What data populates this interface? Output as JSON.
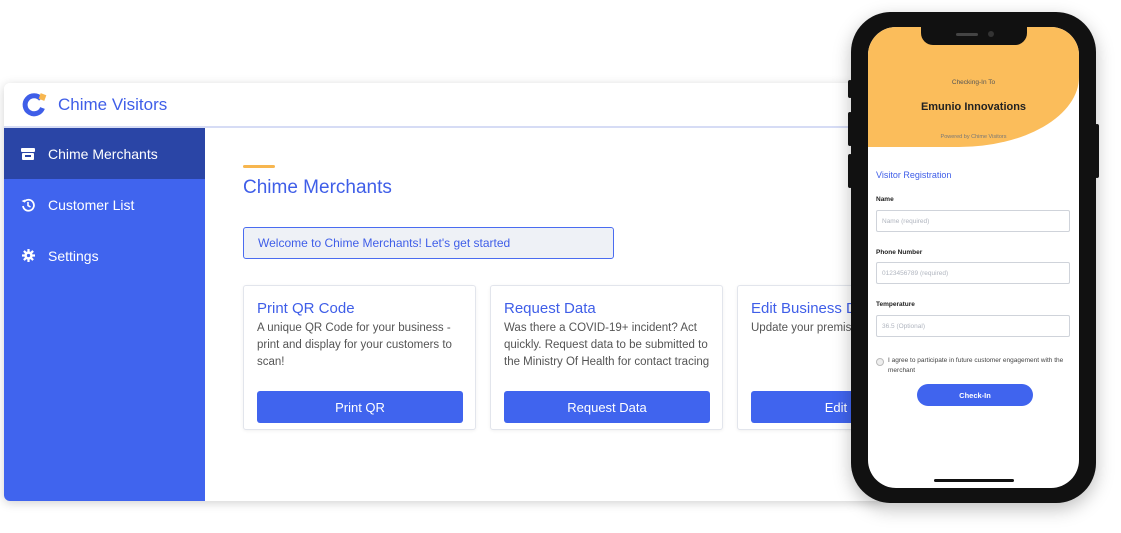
{
  "app": {
    "title": "Chime Visitors",
    "colors": {
      "brand": "#3f5ee8",
      "sidebar": "#4064ee",
      "sidebar_active": "#2a45a6",
      "accent": "#f7b64f"
    }
  },
  "sidebar": {
    "items": [
      {
        "label": "Chime Merchants",
        "icon": "store-icon",
        "active": true
      },
      {
        "label": "Customer List",
        "icon": "history-icon",
        "active": false
      },
      {
        "label": "Settings",
        "icon": "gear-icon",
        "active": false
      }
    ]
  },
  "main": {
    "title": "Chime Merchants",
    "welcome": "Welcome to Chime Merchants! Let's get started",
    "cards": [
      {
        "title": "Print QR Code",
        "description": "A unique QR Code for your business - print and display for your customers to scan!",
        "button": "Print QR"
      },
      {
        "title": "Request Data",
        "description": "Was there a COVID-19+ incident? Act quickly. Request data to be submitted to the Ministry Of Health for contact tracing",
        "button": "Request Data"
      },
      {
        "title": "Edit Business D",
        "description": "Update your premise",
        "button": "Edit Busin"
      }
    ]
  },
  "phone": {
    "checking_in_to": "Checking-In To",
    "business_name": "Emunio Innovations",
    "powered_by": "Powered by Chime Visitors",
    "form_title": "Visitor Registration",
    "fields": [
      {
        "label": "Name",
        "placeholder": "Name (required)"
      },
      {
        "label": "Phone Number",
        "placeholder": "0123456789 (required)"
      },
      {
        "label": "Temperature",
        "placeholder": "36.5 (Optional)"
      }
    ],
    "consent": "I agree to participate in future customer engagement with the merchant",
    "submit": "Check-In",
    "colors": {
      "header": "#fbbd5b"
    }
  }
}
